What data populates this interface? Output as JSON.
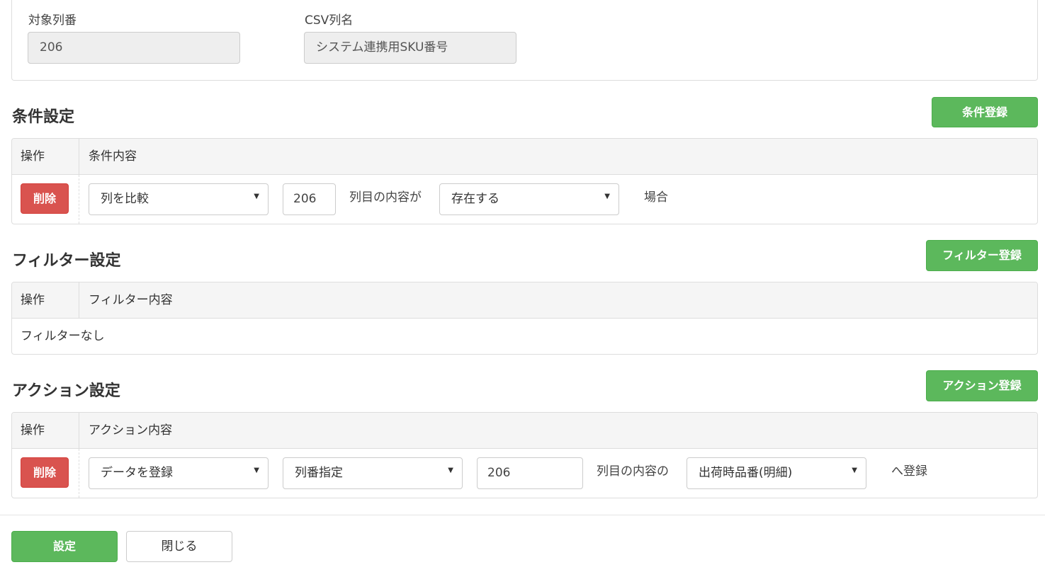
{
  "top": {
    "column_number_label": "対象列番",
    "column_number_value": "206",
    "csv_column_label": "CSV列名",
    "csv_column_value": "システム連携用SKU番号"
  },
  "condition": {
    "title": "条件設定",
    "register_button": "条件登録",
    "header_op": "操作",
    "header_content": "条件内容",
    "row": {
      "delete_button": "削除",
      "type_select": "列を比較",
      "column_input": "206",
      "text1": "列目の内容が",
      "operator_select": "存在する",
      "text2": "場合"
    }
  },
  "filter": {
    "title": "フィルター設定",
    "register_button": "フィルター登録",
    "header_op": "操作",
    "header_content": "フィルター内容",
    "empty_text": "フィルターなし"
  },
  "action": {
    "title": "アクション設定",
    "register_button": "アクション登録",
    "header_op": "操作",
    "header_content": "アクション内容",
    "row": {
      "delete_button": "削除",
      "action_select": "データを登録",
      "mode_select": "列番指定",
      "column_input": "206",
      "text1": "列目の内容の",
      "target_select": "出荷時品番(明細)",
      "text2": "へ登録"
    }
  },
  "footer": {
    "submit_button": "設定",
    "close_button": "閉じる"
  },
  "colors": {
    "success": "#5cb85c",
    "danger": "#d9534f",
    "header_bg": "#f5f5f5"
  }
}
